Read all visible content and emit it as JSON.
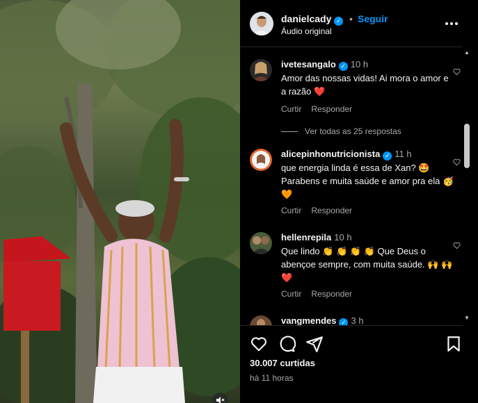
{
  "post": {
    "author": "danielcady",
    "separator": "•",
    "follow_label": "Seguir",
    "audio": "Áudio original",
    "likes": "30.007 curtidas",
    "posted": "há 11 horas"
  },
  "comments": [
    {
      "user": "ivetesangalo",
      "time": "10 h",
      "text": "Amor das nossas vidas! Ai mora o amor e a razão ❤️",
      "reply_label": "Curtir",
      "respond_label": "Responder"
    },
    {
      "user": "alicepinhonutricionista",
      "time": "11 h",
      "text": "que energia linda é essa de Xan? 🤩 Parabens e muita saúde e amor pra ela 🥳 🧡",
      "reply_label": "Curtir",
      "respond_label": "Responder"
    },
    {
      "user": "hellenrepila",
      "time": "10 h",
      "text": "Que lindo 👏 👏 👏 👏 Que Deus o abençoe sempre, com muita saúde. 🙌 🙌 ❤️",
      "reply_label": "Curtir",
      "respond_label": "Responder"
    },
    {
      "user": "vangmendes",
      "time": "3 h"
    }
  ],
  "view_replies": "Ver todas as 25 respostas",
  "icons": [
    "verified-icon",
    "more-icon",
    "heart-icon",
    "comment-icon",
    "share-icon",
    "save-icon",
    "mute-icon"
  ],
  "colors": {
    "background": "#000000",
    "accent": "#0095f6",
    "muted": "#a8a8a8",
    "text": "#f5f5f5"
  }
}
